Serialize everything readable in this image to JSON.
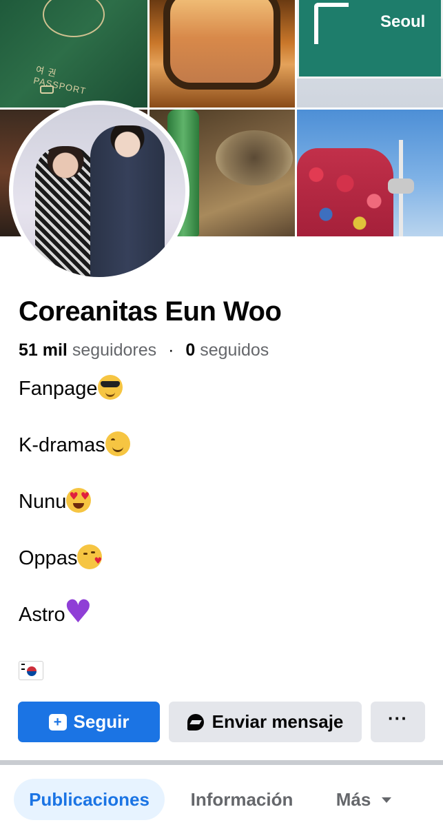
{
  "profile": {
    "name": "Coreanitas Eun Woo",
    "followers_count": "51 mil",
    "followers_label": "seguidores",
    "separator": "·",
    "following_count": "0",
    "following_label": "seguidos"
  },
  "cover": {
    "tiles": [
      {
        "subject": "passport",
        "text_1": "여 권",
        "text_2": "PASSPORT"
      },
      {
        "subject": "airplane-window"
      },
      {
        "subject": "seoul-road-sign",
        "text": "Seoul"
      },
      {
        "subject": "street-at-night"
      },
      {
        "subject": "korean-bbq-table"
      },
      {
        "subject": "n-seoul-tower-love-locks"
      }
    ]
  },
  "bio": [
    {
      "text": "Fanpage",
      "emoji": "smiling-face-with-sunglasses"
    },
    {
      "text": "K-dramas",
      "emoji": "smiling-face-with-smiling-eyes"
    },
    {
      "text": "Nunu",
      "emoji": "smiling-face-with-heart-eyes"
    },
    {
      "text": "Oppas",
      "emoji": "face-blowing-a-kiss"
    },
    {
      "text": "Astro",
      "emoji": "purple-heart"
    },
    {
      "text": "",
      "emoji": "flag-south-korea"
    }
  ],
  "actions": {
    "follow_label": "Seguir",
    "message_label": "Enviar mensaje",
    "more_label": "···"
  },
  "tabs": [
    {
      "label": "Publicaciones",
      "active": true
    },
    {
      "label": "Información",
      "active": false
    },
    {
      "label": "Más",
      "active": false
    }
  ],
  "colors": {
    "primary": "#1b74e4",
    "button_secondary": "#e4e6eb",
    "tab_active_bg": "#e7f3ff",
    "secondary_text": "#65676b",
    "divider": "#c9ccd1"
  }
}
